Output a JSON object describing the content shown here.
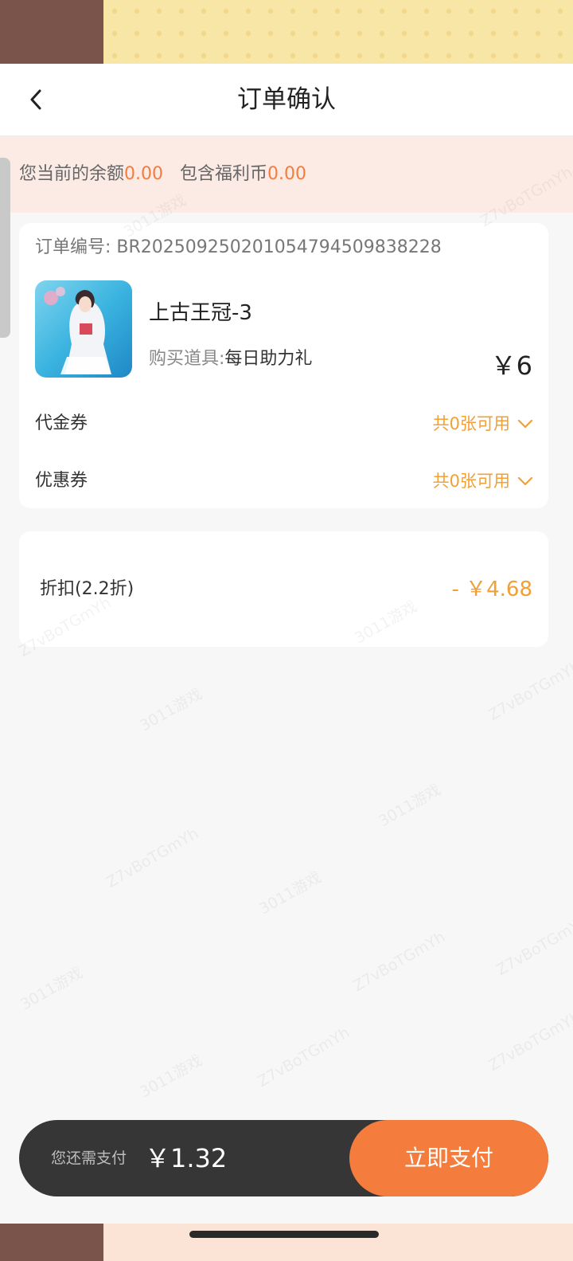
{
  "header": {
    "title": "订单确认",
    "back_icon": "chevron-left-icon"
  },
  "balance": {
    "label": "您当前的余额",
    "value": "0.00",
    "welfare_label": "包含福利币",
    "welfare_value": "0.00"
  },
  "order": {
    "number_label": "订单编号: ",
    "number": "BR20250925020105479450983822​8",
    "game_name": "上古王冠-3",
    "item_label": "购买道具:",
    "item_value": "每日助力礼",
    "price": "￥6"
  },
  "vouchers": [
    {
      "label": "代金券",
      "value": "共0张可用"
    },
    {
      "label": "优惠券",
      "value": "共0张可用"
    }
  ],
  "discount": {
    "label": "折扣(2.2折)",
    "value": "- ￥4.68"
  },
  "watermark": [
    "Z7vBoTGmYh",
    "3011游戏"
  ],
  "pay_bar": {
    "label": "您还需支付",
    "amount": "￥1.32",
    "button": "立即支付"
  },
  "colors": {
    "accent": "#f47c3c",
    "coupon": "#f0a036",
    "pay_bar_bg": "#363636"
  }
}
